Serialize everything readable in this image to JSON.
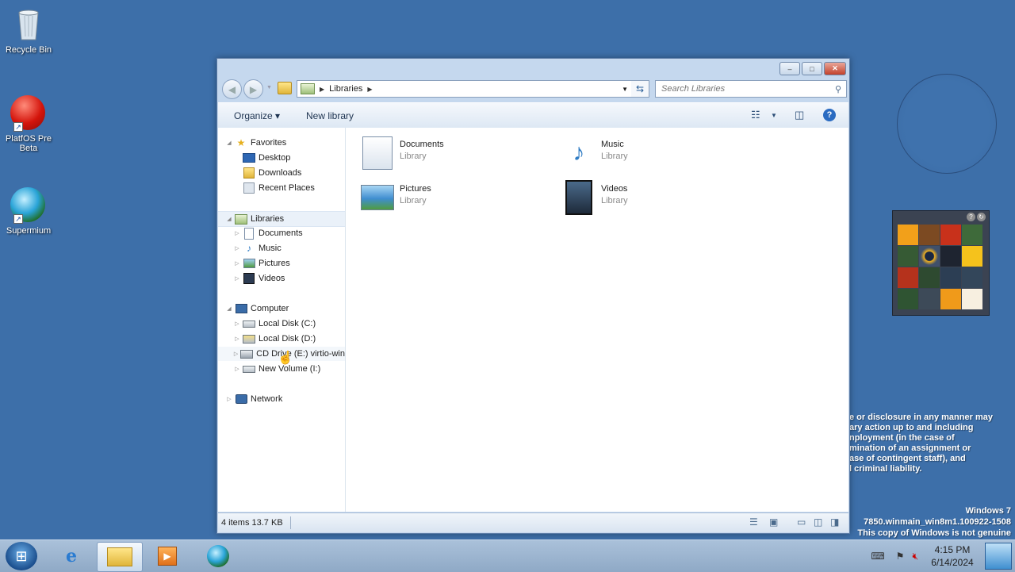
{
  "desktop": {
    "icons": [
      {
        "label": "Recycle Bin",
        "icon": "recycle-bin-icon"
      },
      {
        "label": "PlatfOS Pre Beta",
        "icon": "red-orb-icon"
      },
      {
        "label": "Supermium",
        "icon": "supermium-globe-icon"
      }
    ],
    "watermark": {
      "lines": [
        "e or disclosure in any manner may",
        "ary action up to and including",
        "nployment (in the case of",
        "mination of an assignment or",
        "ase of contingent staff), and",
        "l criminal liability."
      ],
      "os_name": "Windows 7",
      "build": "7850.winmain_win8m1.100922-1508",
      "genuine": "This copy of Windows is not genuine"
    }
  },
  "explorer": {
    "caption_buttons": {
      "minimize": "–",
      "maximize": "□",
      "close": "✕"
    },
    "nav": {
      "back": "◀",
      "forward": "▶"
    },
    "address": {
      "crumb": "Libraries",
      "separator": "▶"
    },
    "search": {
      "placeholder": "Search Libraries"
    },
    "toolbar": {
      "organize_label": "Organize ▾",
      "new_library_label": "New library",
      "help": "?"
    },
    "tree": {
      "favorites": {
        "label": "Favorites",
        "items": [
          "Desktop",
          "Downloads",
          "Recent Places"
        ]
      },
      "libraries": {
        "label": "Libraries",
        "items": [
          "Documents",
          "Music",
          "Pictures",
          "Videos"
        ]
      },
      "computer": {
        "label": "Computer",
        "items": [
          "Local Disk (C:)",
          "Local Disk (D:)",
          "CD Drive (E:) virtio-win",
          "New Volume (I:)"
        ]
      },
      "network": {
        "label": "Network"
      }
    },
    "libraries": [
      {
        "name": "Documents",
        "type": "Library"
      },
      {
        "name": "Music",
        "type": "Library"
      },
      {
        "name": "Pictures",
        "type": "Library"
      },
      {
        "name": "Videos",
        "type": "Library"
      }
    ],
    "status": {
      "text": "4 items  13.7 KB"
    }
  },
  "taskbar": {
    "time": "4:15 PM",
    "date": "6/14/2024"
  },
  "colors": {
    "desktop": "#3d6fa9",
    "window_frame": "#c5d8ee",
    "close_button": "#c2412b"
  }
}
